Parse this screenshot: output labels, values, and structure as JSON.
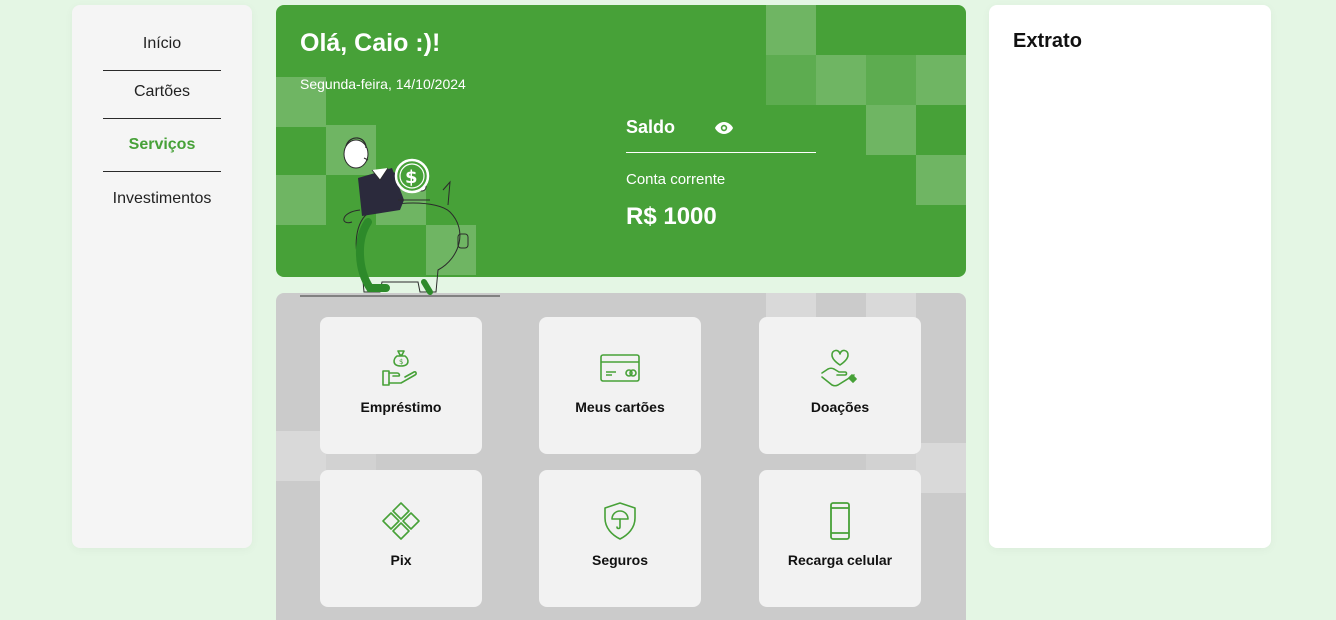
{
  "sidebar": {
    "items": [
      {
        "label": "Início",
        "active": false
      },
      {
        "label": "Cartões",
        "active": false
      },
      {
        "label": "Serviços",
        "active": true
      },
      {
        "label": "Investimentos",
        "active": false
      }
    ]
  },
  "hero": {
    "greeting": "Olá, Caio :)!",
    "date": "Segunda-feira, 14/10/2024",
    "balance_label": "Saldo",
    "balance_toggle_icon": "eye-icon",
    "account_type": "Conta corrente",
    "balance_value": "R$ 1000"
  },
  "services": {
    "items": [
      {
        "label": "Empréstimo",
        "icon": "money-bag-hand-icon"
      },
      {
        "label": "Meus cartões",
        "icon": "credit-card-icon"
      },
      {
        "label": "Doações",
        "icon": "heart-hand-icon"
      },
      {
        "label": "Pix",
        "icon": "pix-icon"
      },
      {
        "label": "Seguros",
        "icon": "shield-umbrella-icon"
      },
      {
        "label": "Recarga celular",
        "icon": "smartphone-icon"
      }
    ]
  },
  "statement": {
    "title": "Extrato"
  },
  "colors": {
    "brand_green": "#47a138",
    "background": "#e4f6e4",
    "panel_gray": "#cbcbcb",
    "card": "#f2f2f2"
  }
}
